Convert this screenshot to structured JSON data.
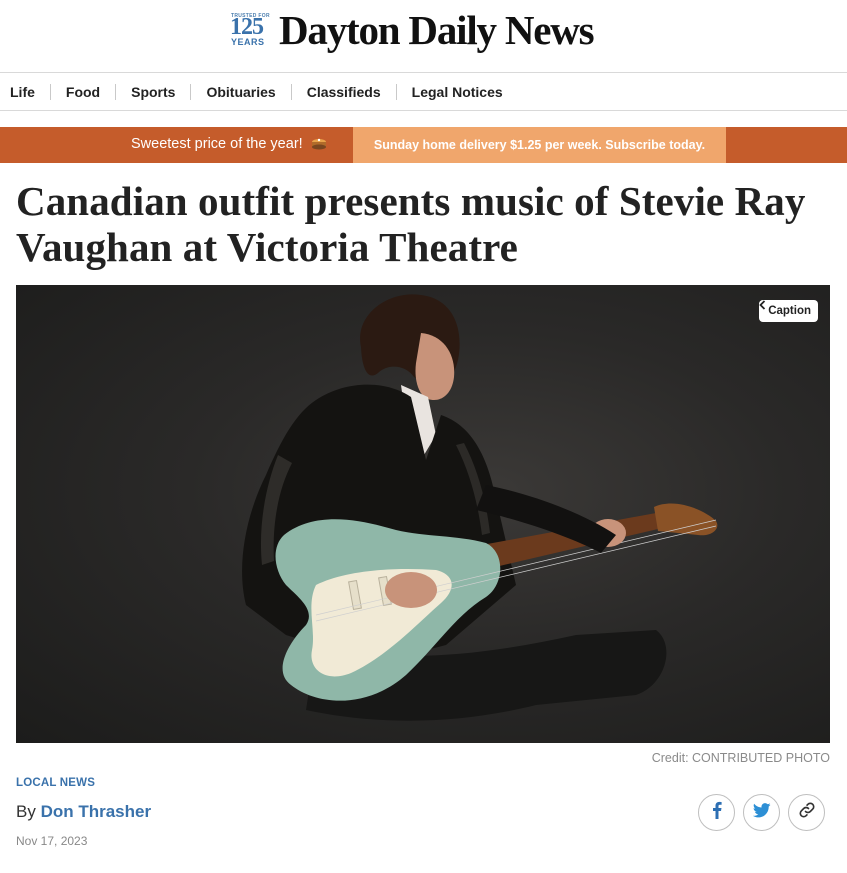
{
  "masthead": {
    "badge_top": "TRUSTED FOR",
    "badge_number": "125",
    "badge_years": "YEARS",
    "title": "Dayton Daily News"
  },
  "nav": {
    "items": [
      "Life",
      "Food",
      "Sports",
      "Obituaries",
      "Classifieds",
      "Legal Notices"
    ]
  },
  "promo": {
    "left_text": "Sweetest price of the year!",
    "right_text": "Sunday home delivery $1.25 per week. Subscribe today.",
    "bar_color": "#c55c2b",
    "highlight_color": "#f0a66c"
  },
  "article": {
    "headline": "Canadian outfit presents music of Stevie Ray Vaughan at Victoria Theatre",
    "caption_button": "Caption",
    "credit": "Credit: CONTRIBUTED PHOTO",
    "section": "LOCAL NEWS",
    "byline_prefix": "By",
    "author": "Don Thrasher",
    "date": "Nov 17, 2023"
  },
  "share": {
    "icons": [
      "facebook-icon",
      "twitter-icon",
      "link-icon"
    ]
  },
  "colors": {
    "accent_blue": "#3a72ab"
  }
}
